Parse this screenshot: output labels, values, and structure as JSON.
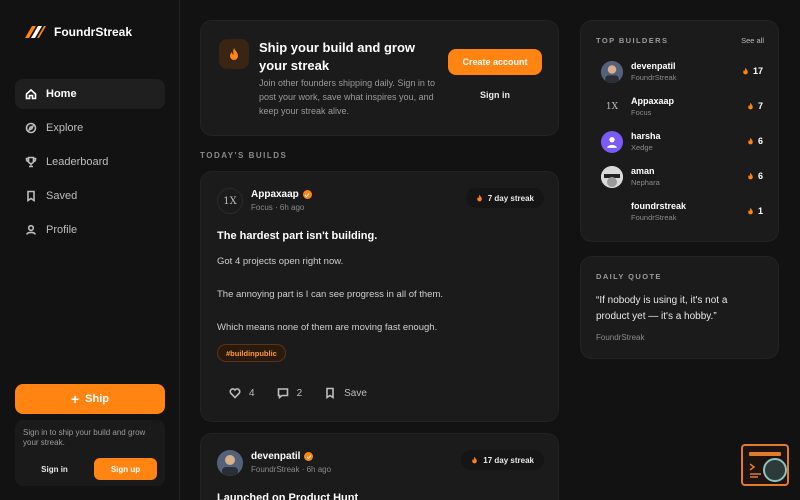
{
  "brand": {
    "name": "FoundrStreak"
  },
  "sidebar": {
    "items": [
      {
        "label": "Home",
        "icon": "home-icon",
        "active": true
      },
      {
        "label": "Explore",
        "icon": "compass-icon",
        "active": false
      },
      {
        "label": "Leaderboard",
        "icon": "trophy-icon",
        "active": false
      },
      {
        "label": "Saved",
        "icon": "bookmark-icon",
        "active": false
      },
      {
        "label": "Profile",
        "icon": "user-icon",
        "active": false
      }
    ],
    "ship_label": "Ship",
    "signin_note": "Sign in to ship your build and grow your streak.",
    "signin_label": "Sign in",
    "signup_label": "Sign up"
  },
  "hero": {
    "title": "Ship your build and grow your streak",
    "text": "Join other founders shipping daily. Sign in to post your work, save what inspires you, and keep your streak alive.",
    "create_label": "Create account",
    "signin_label": "Sign in"
  },
  "feed": {
    "section_label": "TODAY'S BUILDS",
    "posts": [
      {
        "author": "Appaxaap",
        "project": "Focus",
        "time": "6h ago",
        "streak": "7 day streak",
        "title": "The hardest part isn't building.",
        "body": [
          "Got 4 projects open right now.",
          "The annoying part is I can see progress in all of them.",
          "Which means none of them are moving fast enough."
        ],
        "tag": "#buildinpublic",
        "likes": "4",
        "comments": "2",
        "save_label": "Save"
      },
      {
        "author": "devenpatil",
        "project": "FoundrStreak",
        "time": "6h ago",
        "streak": "17 day streak",
        "title": "Launched on Product Hunt"
      }
    ]
  },
  "top_builders": {
    "title": "TOP BUILDERS",
    "see_all": "See all",
    "items": [
      {
        "name": "devenpatil",
        "project": "FoundrStreak",
        "count": "17"
      },
      {
        "name": "Appaxaap",
        "project": "Focus",
        "count": "7"
      },
      {
        "name": "harsha",
        "project": "Xedge",
        "count": "6"
      },
      {
        "name": "aman",
        "project": "Nephara",
        "count": "6"
      },
      {
        "name": "foundrstreak",
        "project": "FoundrStreak",
        "count": "1"
      }
    ]
  },
  "quote": {
    "title": "DAILY QUOTE",
    "text": "“If nobody is using it, it's not a product yet — it's a hobby.”",
    "author": "FoundrStreak"
  },
  "colors": {
    "accent": "#ff8412",
    "background": "#121212",
    "card": "#1b1b1b"
  }
}
